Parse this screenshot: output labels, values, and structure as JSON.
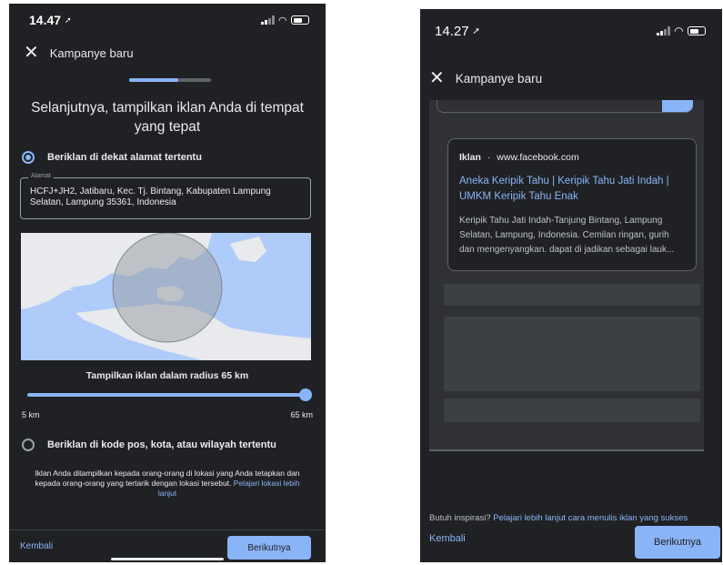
{
  "left": {
    "status": {
      "time": "14.47"
    },
    "appbar": {
      "title": "Kampanye baru"
    },
    "step_progress": 0.6,
    "heading": "Selanjutnya, tampilkan iklan Anda di tempat yang tepat",
    "option_address": "Beriklan di dekat alamat tertentu",
    "address_field": {
      "label": "Alamat",
      "value": "HCFJ+JH2, Jatibaru, Kec. Tj. Bintang, Kabupaten Lampung Selatan, Lampung 35361, Indonesia"
    },
    "radius": {
      "label": "Tampilkan iklan dalam radius 65 km",
      "min_label": "5 km",
      "max_label": "65 km",
      "value_km": 65
    },
    "option_region": "Beriklan di kode pos, kota, atau wilayah tertentu",
    "note": {
      "text": "Iklan Anda ditampilkan kepada orang-orang di lokasi yang Anda tetapkan dan kepada orang-orang yang tertarik dengan lokasi tersebut.",
      "link": "Pelajari lokasi lebih lanjut"
    },
    "footer": {
      "back": "Kembali",
      "next": "Berikutnya"
    }
  },
  "right": {
    "status": {
      "time": "14.27"
    },
    "appbar": {
      "title": "Kampanye baru"
    },
    "ad_preview": {
      "label": "Iklan",
      "separator": "·",
      "domain": "www.facebook.com",
      "headline": "Aneka Keripik Tahu | Keripik Tahu Jati Indah | UMKM Keripik Tahu Enak",
      "description": "Keripik Tahu Jati Indah-Tanjung Bintang, Lampung Selatan, Lampung, Indonesia. Cemilan ringan, gurih dan mengenyangkan. dapat di jadikan sebagai lauk..."
    },
    "hint": {
      "text": "Butuh inspirasi?",
      "link": "Pelajari lebih lanjut cara menulis iklan yang sukses"
    },
    "footer": {
      "back": "Kembali",
      "next": "Berikutnya"
    }
  },
  "icons": {
    "close": "close-icon",
    "location": "navigation-arrow-icon",
    "signal": "signal-icon",
    "wifi": "wifi-icon",
    "battery": "battery-icon"
  },
  "colors": {
    "background": "#202124",
    "accent": "#8ab4f8",
    "text": "#e8eaed",
    "map_water": "#aecbfa",
    "map_land": "#e8eaed"
  }
}
